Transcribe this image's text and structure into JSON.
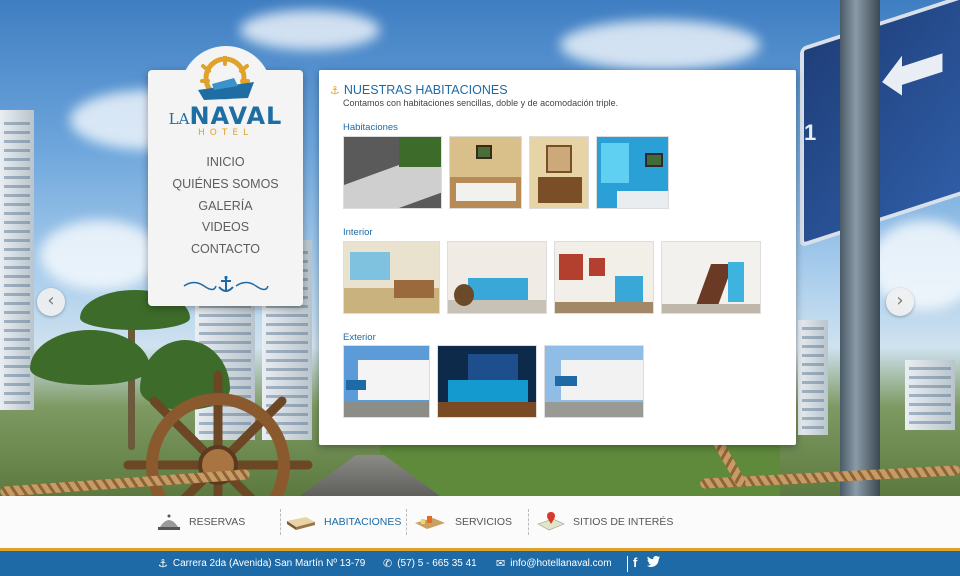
{
  "brand": {
    "la": "LA",
    "naval": "NAVAL",
    "hotel": "HOTEL"
  },
  "menu": {
    "items": [
      {
        "label": "INICIO"
      },
      {
        "label": "QUIÉNES SOMOS"
      },
      {
        "label": "GALERÍA"
      },
      {
        "label": "VIDEOS"
      },
      {
        "label": "CONTACTO"
      }
    ],
    "ornament_icon": "anchor-icon"
  },
  "content": {
    "title": "NUESTRAS HABITACIONES",
    "subtitle": "Contamos con habitaciones sencillas, doble y de acomodación triple.",
    "sections": [
      {
        "title": "Habitaciones",
        "thumb_count": 4
      },
      {
        "title": "Interior",
        "thumb_count": 4
      },
      {
        "title": "Exterior",
        "thumb_count": 3
      }
    ]
  },
  "slider": {
    "prev_icon": "chevron-left-icon",
    "next_icon": "chevron-right-icon"
  },
  "bottom_nav": {
    "items": [
      {
        "label": "RESERVAS",
        "icon": "bell-icon",
        "active": false
      },
      {
        "label": "HABITACIONES",
        "icon": "bed-icon",
        "active": true
      },
      {
        "label": "SERVICIOS",
        "icon": "tray-icon",
        "active": false
      },
      {
        "label": "SITIOS DE INTERÉS",
        "icon": "map-pin-icon",
        "active": false
      }
    ]
  },
  "footer": {
    "address": "Carrera 2da (Avenida) San Martín Nº 13-79",
    "phone": "(57) 5 - 665 35 41",
    "email": "info@hotellanaval.com",
    "social": [
      "facebook-icon",
      "twitter-icon"
    ]
  },
  "colors": {
    "primary": "#1d6aa6",
    "accent": "#e0a22a",
    "panel": "#ffffff"
  }
}
